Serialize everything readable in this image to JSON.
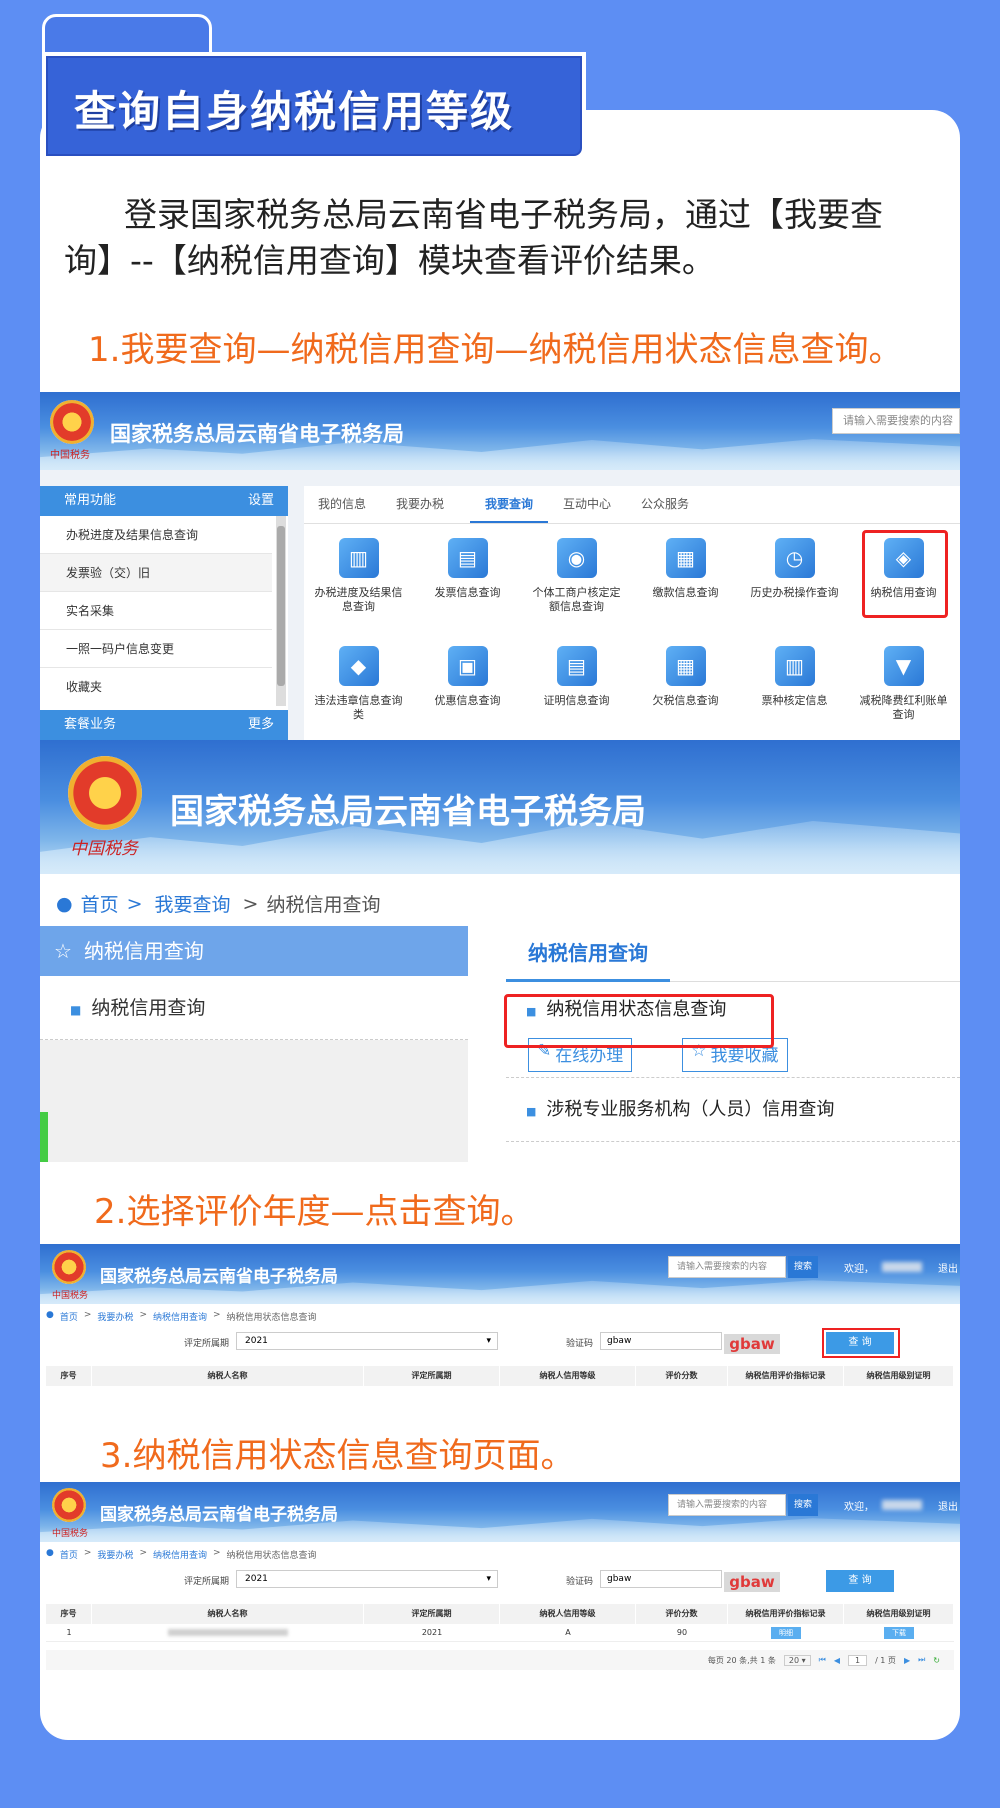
{
  "heading": "查询自身纳税信用等级",
  "intro": "登录国家税务总局云南省电子税务局，通过【我要查询】--【纳税信用查询】模块查看评价结果。",
  "steps": {
    "step1": "1.我要查询—纳税信用查询—纳税信用状态信息查询。",
    "step2": "2.选择评价年度—点击查询。",
    "step3": "3.纳税信用状态信息查询页面。"
  },
  "site": {
    "name": "国家税务总局云南省电子税务局",
    "seal_text": "中国税务",
    "search_placeholder": "请输入需要搜索的内容",
    "search_button": "搜索",
    "welcome": "欢迎，",
    "logout": "退出"
  },
  "screen1": {
    "sidebar_header": "常用功能",
    "sidebar_setting": "设置",
    "sidebar_items": [
      "办税进度及结果信息查询",
      "发票验（交）旧",
      "实名采集",
      "一照一码户信息变更",
      "收藏夹"
    ],
    "sidebar_footer": "套餐业务",
    "sidebar_more": "更多",
    "tabs": [
      "我的信息",
      "我要办税",
      "我要查询",
      "互动中心",
      "公众服务"
    ],
    "active_tab": "我要查询",
    "tiles": [
      {
        "label": "办税进度及结果信息查询",
        "icon": "progress-chart-icon"
      },
      {
        "label": "发票信息查询",
        "icon": "printer-invoice-icon"
      },
      {
        "label": "个体工商户核定定额信息查询",
        "icon": "person-card-icon"
      },
      {
        "label": "缴款信息查询",
        "icon": "document-search-icon"
      },
      {
        "label": "历史办税操作查询",
        "icon": "history-clock-icon"
      },
      {
        "label": "纳税信用查询",
        "icon": "credit-search-icon"
      },
      {
        "label": "违法违章信息查询类",
        "icon": "car-search-icon"
      },
      {
        "label": "优惠信息查询",
        "icon": "ticket-search-icon"
      },
      {
        "label": "证明信息查询",
        "icon": "certificate-search-icon"
      },
      {
        "label": "欠税信息查询",
        "icon": "calendar-search-icon"
      },
      {
        "label": "票种核定信息",
        "icon": "ticket-type-icon"
      },
      {
        "label": "减税降费红利账单查询",
        "icon": "bill-download-icon"
      }
    ]
  },
  "screen2": {
    "breadcrumb": [
      "首页",
      "我要查询",
      "纳税信用查询"
    ],
    "left_title": "纳税信用查询",
    "left_item": "纳税信用查询",
    "right_tab": "纳税信用查询",
    "items": [
      "纳税信用状态信息查询",
      "涉税专业服务机构（人员）信用查询"
    ],
    "online_button": "在线办理",
    "fav_button": "我要收藏"
  },
  "query": {
    "breadcrumb": [
      "首页",
      "我要办税",
      "纳税信用查询",
      "纳税信用状态信息查询"
    ],
    "period_label": "评定所属期",
    "period_value": "2021",
    "captcha_label": "验证码",
    "captcha_input": "gbaw",
    "captcha_image": "gbaw",
    "query_button": "查 询",
    "columns": [
      "序号",
      "纳税人名称",
      "评定所属期",
      "纳税人信用等级",
      "评价分数",
      "纳税信用评价指标记录",
      "纳税信用级别证明"
    ]
  },
  "result": {
    "row": {
      "index": "1",
      "name": "",
      "period": "2021",
      "grade": "A",
      "score": "90",
      "detail_button": "明细",
      "download_button": "下载"
    },
    "pager": {
      "summary": "每页 20 条,共 1 条",
      "page_size": "20",
      "current_page": "1",
      "total_pages": "/ 1 页"
    }
  },
  "colors": {
    "accent_blue": "#3c8fe0",
    "orange": "#f06a1c",
    "highlight_red": "#e22222",
    "page_bg": "#5d8ef3"
  }
}
